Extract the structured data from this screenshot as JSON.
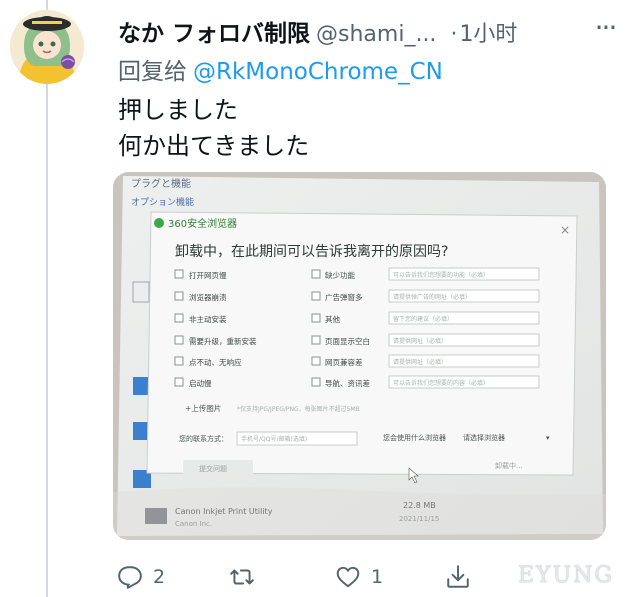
{
  "tweet": {
    "display_name": "なか フォロバ制限",
    "handle": "@shami_...",
    "separator": "·",
    "time": "1小时",
    "more_icon": "more-dots-icon",
    "reply_prefix": "回复给",
    "reply_to": "@RkMonoChrome_CN",
    "text_lines": [
      "押しました",
      "何か出てきました"
    ]
  },
  "photo": {
    "bg_title": "プラグと機能",
    "bg_option": "オプション機能",
    "app_name": "360安全浏览器",
    "dialog_title": "卸载中，在此期间可以告诉我离开的原因吗?",
    "left_options": [
      "打开网页慢",
      "浏览器崩溃",
      "非主动安装",
      "需要升级，重新安装",
      "点不动、无响应",
      "启动慢"
    ],
    "right_options": [
      "缺少功能",
      "广告弹窗多",
      "其他",
      "页面显示空白",
      "网页兼容差",
      "导航、资讯差"
    ],
    "right_placeholders": [
      "可以告诉我们您想要的功能（必填）",
      "请提供弹广告的网址（必填）",
      "留下您的建议（必填）",
      "请提供网址（必填）",
      "请提供网址（必填）",
      "可以告诉我们您想要的内容（必填）"
    ],
    "upload_label": "+上传图片",
    "upload_hint": "*仅支持JPG/JPEG/PNG，每张图片不超过5MB",
    "contact_label": "您的联系方式：",
    "contact_placeholder": "手机号/QQ号/邮箱(选填)",
    "next_browser_label": "您会使用什么浏览器",
    "next_browser_select": "请选择浏览器",
    "submit_label": "提交问题",
    "uninstall_label": "卸载中...",
    "program_name": "Canon Inkjet Print Utility",
    "program_vendor": "Canon Inc.",
    "program_size": "22.8 MB",
    "program_date": "2021/11/15"
  },
  "actions": {
    "reply": {
      "icon": "reply-icon",
      "count": "2"
    },
    "retweet": {
      "icon": "retweet-icon",
      "count": ""
    },
    "like": {
      "icon": "heart-icon",
      "count": "1"
    },
    "share": {
      "icon": "share-icon",
      "count": ""
    }
  },
  "watermark": "EYUNG",
  "colors": {
    "link": "#1d9bf0",
    "muted": "#536471",
    "text": "#0f1419",
    "rail": "#cfd9de"
  }
}
